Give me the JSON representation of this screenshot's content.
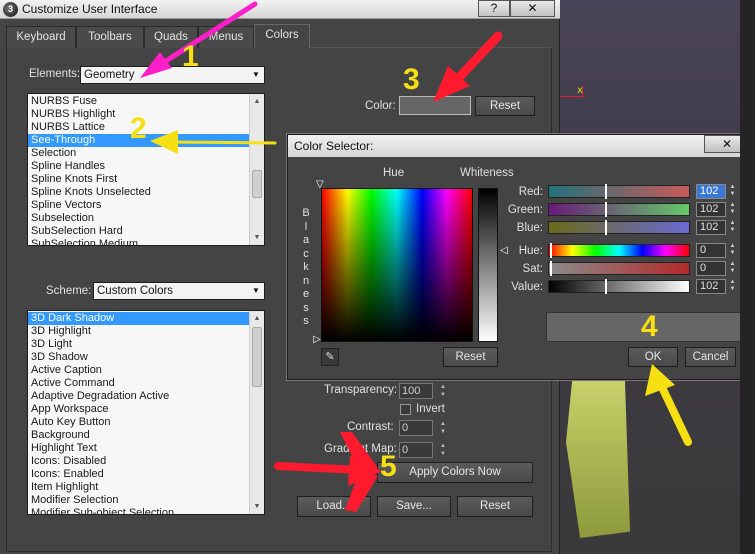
{
  "window": {
    "title": "Customize User Interface",
    "help_label": "?",
    "close_label": "✕"
  },
  "tabs": [
    {
      "label": "Keyboard"
    },
    {
      "label": "Toolbars"
    },
    {
      "label": "Quads"
    },
    {
      "label": "Menus"
    },
    {
      "label": "Colors"
    }
  ],
  "elements": {
    "label": "Elements:",
    "value": "Geometry"
  },
  "element_list": [
    {
      "label": "NURBS Fuse"
    },
    {
      "label": "NURBS Highlight"
    },
    {
      "label": "NURBS Lattice"
    },
    {
      "label": "See-Through",
      "selected": true
    },
    {
      "label": "Selection"
    },
    {
      "label": "Spline Handles"
    },
    {
      "label": "Spline Knots First"
    },
    {
      "label": "Spline Knots Unselected"
    },
    {
      "label": "Spline Vectors"
    },
    {
      "label": "Subselection"
    },
    {
      "label": "SubSelection Hard"
    },
    {
      "label": "SubSelection Medium"
    }
  ],
  "color_row": {
    "label": "Color:",
    "reset_label": "Reset",
    "swatch_color": "#666666"
  },
  "scheme": {
    "label": "Scheme:",
    "value": "Custom Colors"
  },
  "scheme_list": [
    {
      "label": "3D Dark Shadow",
      "selected": true
    },
    {
      "label": "3D Highlight"
    },
    {
      "label": "3D Light"
    },
    {
      "label": "3D Shadow"
    },
    {
      "label": "Active Caption"
    },
    {
      "label": "Active Command"
    },
    {
      "label": "Adaptive Degradation Active"
    },
    {
      "label": "App Workspace"
    },
    {
      "label": "Auto Key Button"
    },
    {
      "label": "Background"
    },
    {
      "label": "Highlight Text"
    },
    {
      "label": "Icons: Disabled"
    },
    {
      "label": "Icons: Enabled"
    },
    {
      "label": "Item Highlight"
    },
    {
      "label": "Modifier Selection"
    },
    {
      "label": "Modifier Sub-object Selection"
    }
  ],
  "lower_controls": {
    "transparency_label": "Transparency:",
    "transparency_value": "100",
    "invert_label": "Invert",
    "contrast_label": "Contrast:",
    "contrast_value": "0",
    "gradient_label": "Gradient Map:",
    "gradient_value": "0",
    "apply_label": "Apply Colors Now",
    "load_label": "Load...",
    "save_label": "Save...",
    "reset_label": "Reset"
  },
  "color_selector": {
    "title": "Color Selector:",
    "close_label": "✕",
    "hue_label": "Hue",
    "whiteness_label": "Whiteness",
    "blackness_label": "Blackness",
    "red_label": "Red:",
    "red_value": "102",
    "green_label": "Green:",
    "green_value": "102",
    "blue_label": "Blue:",
    "blue_value": "102",
    "hue_value_label": "Hue:",
    "hue_value": "0",
    "sat_label": "Sat:",
    "sat_value": "0",
    "value_label": "Value:",
    "value_value": "102",
    "reset_label": "Reset",
    "ok_label": "OK",
    "cancel_label": "Cancel",
    "preview_color": "#666666"
  },
  "annotations": {
    "step1": "1",
    "step2": "2",
    "step3": "3",
    "step4": "4",
    "step5": "5",
    "arrow_pink": "#ff1fc8",
    "arrow_red": "#ff1a2e",
    "arrow_yellow": "#f6e014"
  }
}
